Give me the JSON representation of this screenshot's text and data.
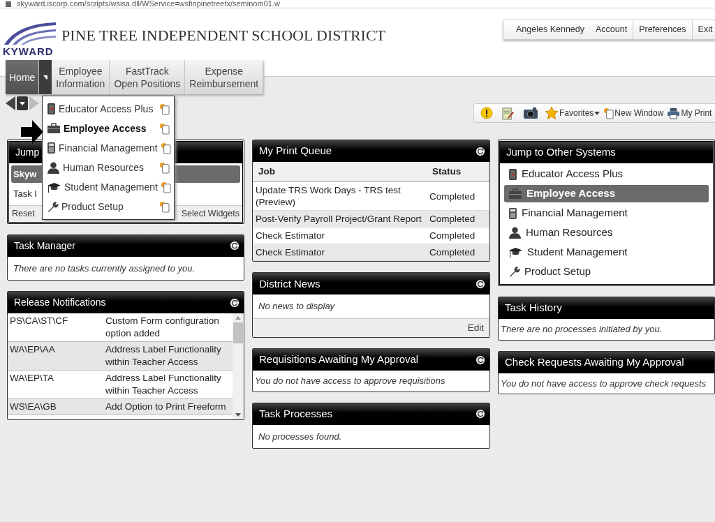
{
  "address_bar": {
    "url": "skyward.iscorp.com/scripts/wsisa.dll/WService=wsfinpinetreetx/seminom01.w"
  },
  "header": {
    "logo_text": "KYWARD",
    "district_name": "PINE TREE INDEPENDENT SCHOOL DISTRICT"
  },
  "user_menu": [
    {
      "label": "Angeles Kennedy"
    },
    {
      "label": "Account"
    },
    {
      "label": "Preferences"
    },
    {
      "label": "Exit"
    }
  ],
  "nav_tabs": [
    {
      "lines": [
        "Home"
      ],
      "selected": true,
      "has_menu": true
    },
    {
      "lines": [
        "Employee",
        "Information"
      ],
      "selected": false,
      "has_menu": false
    },
    {
      "lines": [
        "FastTrack",
        "Open Positions"
      ],
      "selected": false,
      "has_menu": false
    },
    {
      "lines": [
        "Expense",
        "Reimbursement"
      ],
      "selected": false,
      "has_menu": false
    }
  ],
  "home_menu": {
    "items": [
      {
        "label": "Educator Access Plus",
        "kind": "book",
        "selected": false
      },
      {
        "label": "Employee Access",
        "kind": "briefcase",
        "selected": true
      },
      {
        "label": "Financial Management",
        "kind": "calculator",
        "selected": false
      },
      {
        "label": "Human Resources",
        "kind": "person",
        "selected": false
      },
      {
        "label": "Student Management",
        "kind": "gradcap",
        "selected": false
      },
      {
        "label": "Product Setup",
        "kind": "wrench",
        "selected": false
      }
    ]
  },
  "toolbar": [
    {
      "kind": "alert"
    },
    {
      "kind": "notes"
    },
    {
      "kind": "camera"
    },
    {
      "kind": "favorites",
      "label": "Favorites"
    },
    {
      "kind": "new_window",
      "label": "New Window"
    },
    {
      "kind": "print",
      "label": "My Print"
    }
  ],
  "columns": [
    {
      "widgets": [
        {
          "kind": "links",
          "title": "Jump",
          "framed": true,
          "refresh_icon": false,
          "items": [
            {
              "label": "Skyw",
              "selected": true
            },
            {
              "label": "Task I",
              "selected": false
            }
          ],
          "footer": [
            "Reset",
            "Select Widgets"
          ]
        },
        {
          "kind": "message",
          "title": "Task Manager",
          "framed": false,
          "refresh_icon": true,
          "message": "There are no tasks currently assigned to you."
        },
        {
          "kind": "notes",
          "title": "Release Notifications",
          "framed": false,
          "refresh_icon": true,
          "rows": [
            {
              "code": "PS\\CA\\ST\\CF",
              "description": "Custom Form configuration option added"
            },
            {
              "code": "WA\\EP\\AA",
              "description": "Address Label Functionality within Teacher Access"
            },
            {
              "code": "WA\\EP\\TA",
              "description": "Address Label Functionality within Teacher Access"
            },
            {
              "code": "WS\\EA\\GB",
              "description": "Add Option to Print Freeform"
            }
          ]
        }
      ]
    },
    {
      "widgets": [
        {
          "kind": "table",
          "title": "My Print Queue",
          "framed": false,
          "refresh_icon": true,
          "columns": [
            "Job",
            "Status"
          ],
          "rows": [
            [
              "Update TRS Work Days - TRS test (Preview)",
              "Completed"
            ],
            [
              "Post-Verify Payroll Project/Grant Report",
              "Completed"
            ],
            [
              "Check Estimator",
              "Completed"
            ],
            [
              "Check Estimator",
              "Completed"
            ]
          ]
        },
        {
          "kind": "message",
          "title": "District News",
          "framed": false,
          "refresh_icon": true,
          "message": "No news to display",
          "footer_link": "Edit"
        },
        {
          "kind": "message",
          "title": "Requisitions Awaiting My Approval",
          "framed": false,
          "refresh_icon": true,
          "message": "You do not have access to approve requisitions"
        },
        {
          "kind": "message",
          "title": "Task Processes",
          "framed": false,
          "refresh_icon": true,
          "message": "No processes found."
        }
      ]
    },
    {
      "widgets": [
        {
          "kind": "links",
          "title": "Jump to Other Systems",
          "framed": true,
          "refresh_icon": false,
          "items": [
            {
              "label": "Educator Access Plus",
              "kind": "book",
              "selected": false
            },
            {
              "label": "Employee Access",
              "kind": "briefcase",
              "selected": true
            },
            {
              "label": "Financial Management",
              "kind": "calculator",
              "selected": false
            },
            {
              "label": "Human Resources",
              "kind": "person",
              "selected": false
            },
            {
              "label": "Student Management",
              "kind": "gradcap",
              "selected": false
            },
            {
              "label": "Product Setup",
              "kind": "wrench",
              "selected": false
            }
          ]
        },
        {
          "kind": "message",
          "title": "Task History",
          "framed": false,
          "refresh_icon": false,
          "message": "There are no processes initiated by you."
        },
        {
          "kind": "message",
          "title": "Check Requests Awaiting My Approval",
          "framed": false,
          "refresh_icon": false,
          "message": "You do not have access to approve check requests"
        }
      ]
    }
  ]
}
